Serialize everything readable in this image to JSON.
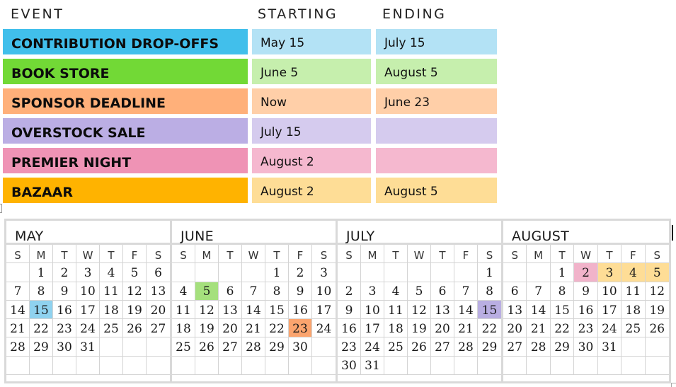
{
  "headers": {
    "event": "EVENT",
    "starting": "STARTING",
    "ending": "ENDING"
  },
  "events": [
    {
      "name": "CONTRIBUTION DROP-OFFS",
      "starting": "May 15",
      "ending": "July 15",
      "color": "#41bfeb",
      "light_color": "#b3e2f5"
    },
    {
      "name": "BOOK STORE",
      "starting": "June 5",
      "ending": "August 5",
      "color": "#72d936",
      "light_color": "#c6efad"
    },
    {
      "name": "SPONSOR DEADLINE",
      "starting": "Now",
      "ending": "June 23",
      "color": "#ffb07a",
      "light_color": "#ffcfa8"
    },
    {
      "name": "OVERSTOCK SALE",
      "starting": "July 15",
      "ending": "",
      "color": "#bbaee4",
      "light_color": "#d5cbee"
    },
    {
      "name": "PREMIER NIGHT",
      "starting": "August 2",
      "ending": "",
      "color": "#ef93b5",
      "light_color": "#f5b8cf"
    },
    {
      "name": "BAZAAR",
      "starting": "August 2",
      "ending": "August 5",
      "color": "#ffb300",
      "light_color": "#fedd96"
    }
  ],
  "calendar": {
    "weekday_labels": [
      "S",
      "M",
      "T",
      "W",
      "T",
      "F",
      "S"
    ],
    "months": [
      {
        "name": "MAY",
        "days": [
          "",
          "1",
          "2",
          "3",
          "4",
          "5",
          "6",
          "7",
          "8",
          "9",
          "10",
          "11",
          "12",
          "13",
          "14",
          "15",
          "16",
          "17",
          "18",
          "19",
          "20",
          "21",
          "22",
          "23",
          "24",
          "25",
          "26",
          "27",
          "28",
          "29",
          "30",
          "31",
          "",
          "",
          "",
          "",
          "",
          "",
          "",
          "",
          "",
          ""
        ],
        "highlights": {
          "15": "#8fd2ef"
        }
      },
      {
        "name": "JUNE",
        "days": [
          "",
          "",
          "",
          "",
          "1",
          "2",
          "3",
          "4",
          "5",
          "6",
          "7",
          "8",
          "9",
          "10",
          "11",
          "12",
          "13",
          "14",
          "15",
          "16",
          "17",
          "18",
          "19",
          "20",
          "21",
          "22",
          "23",
          "24",
          "25",
          "26",
          "27",
          "28",
          "29",
          "30",
          "",
          "",
          "",
          "",
          "",
          "",
          "",
          ""
        ],
        "highlights": {
          "5": "#a5e07d",
          "23": "#fba46e"
        }
      },
      {
        "name": "JULY",
        "days": [
          "",
          "",
          "",
          "",
          "",
          "",
          "1",
          "2",
          "3",
          "4",
          "5",
          "6",
          "7",
          "8",
          "9",
          "10",
          "11",
          "12",
          "13",
          "14",
          "15",
          "16",
          "17",
          "18",
          "19",
          "20",
          "21",
          "22",
          "23",
          "24",
          "25",
          "26",
          "27",
          "28",
          "29",
          "30",
          "31",
          "",
          "",
          "",
          "",
          ""
        ],
        "highlights": {
          "15": "#b9aee2"
        }
      },
      {
        "name": "AUGUST",
        "days": [
          "",
          "",
          "1",
          "2",
          "3",
          "4",
          "5",
          "6",
          "7",
          "8",
          "9",
          "10",
          "11",
          "12",
          "13",
          "14",
          "15",
          "16",
          "17",
          "18",
          "19",
          "20",
          "21",
          "22",
          "23",
          "24",
          "25",
          "26",
          "27",
          "28",
          "29",
          "30",
          "31",
          "",
          "",
          "",
          "",
          "",
          "",
          "",
          "",
          ""
        ],
        "highlights": {
          "2": "#f1b3ca",
          "3": "#fedd96",
          "4": "#fedd96",
          "5": "#fedd96"
        }
      }
    ]
  }
}
